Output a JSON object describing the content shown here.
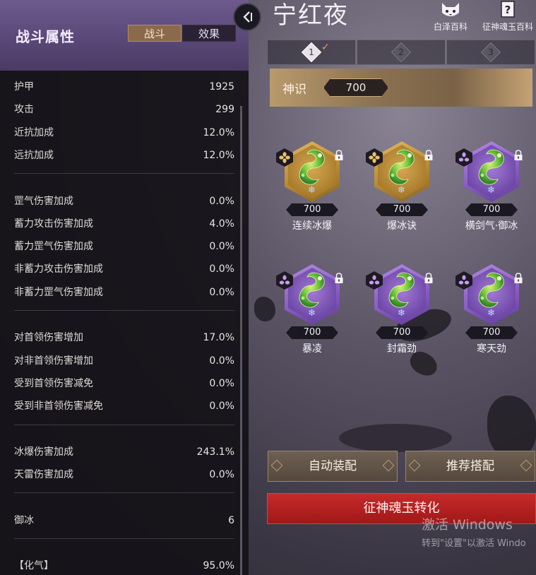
{
  "left_panel": {
    "title": "战斗属性",
    "tabs": [
      {
        "label": "战斗",
        "active": true
      },
      {
        "label": "效果",
        "active": false
      }
    ],
    "groups": [
      [
        {
          "label": "护甲",
          "value": "1925"
        },
        {
          "label": "攻击",
          "value": "299"
        },
        {
          "label": "近抗加成",
          "value": "12.0%"
        },
        {
          "label": "远抗加成",
          "value": "12.0%"
        }
      ],
      [
        {
          "label": "罡气伤害加成",
          "value": "0.0%"
        },
        {
          "label": "蓄力攻击伤害加成",
          "value": "4.0%"
        },
        {
          "label": "蓄力罡气伤害加成",
          "value": "0.0%"
        },
        {
          "label": "非蓄力攻击伤害加成",
          "value": "0.0%"
        },
        {
          "label": "非蓄力罡气伤害加成",
          "value": "0.0%"
        }
      ],
      [
        {
          "label": "对首领伤害增加",
          "value": "17.0%"
        },
        {
          "label": "对非首领伤害增加",
          "value": "0.0%"
        },
        {
          "label": "受到首领伤害减免",
          "value": "0.0%"
        },
        {
          "label": "受到非首领伤害减免",
          "value": "0.0%"
        }
      ],
      [
        {
          "label": "冰爆伤害加成",
          "value": "243.1%"
        },
        {
          "label": "天雷伤害加成",
          "value": "0.0%"
        }
      ],
      [
        {
          "label": "御冰",
          "value": "6"
        }
      ],
      [
        {
          "label": "【化气】",
          "value": "95.0%"
        }
      ]
    ]
  },
  "header": {
    "title": "宁红夜",
    "links": [
      {
        "label": "白泽百科",
        "icon": "baize-cat-icon"
      },
      {
        "label": "征神魂玉百科",
        "icon": "book-question-icon"
      }
    ]
  },
  "tabs": [
    {
      "number": "1",
      "selected": true
    },
    {
      "number": "2",
      "selected": false
    },
    {
      "number": "3",
      "selected": false
    }
  ],
  "shenshi": {
    "label": "神识",
    "value": "700"
  },
  "jades": [
    {
      "name": "连续冰爆",
      "cost": "700",
      "rarity": "gold",
      "rank_icon": "four-petal-icon",
      "locked": true
    },
    {
      "name": "爆冰诀",
      "cost": "700",
      "rarity": "gold",
      "rank_icon": "four-petal-icon",
      "locked": true
    },
    {
      "name": "横剑气·御冰",
      "cost": "700",
      "rarity": "purple",
      "rank_icon": "three-petal-icon",
      "locked": true
    },
    {
      "name": "暴凌",
      "cost": "700",
      "rarity": "purple",
      "rank_icon": "three-petal-icon",
      "locked": true
    },
    {
      "name": "封霜劲",
      "cost": "700",
      "rarity": "purple",
      "rank_icon": "three-petal-icon",
      "locked": true
    },
    {
      "name": "寒天劲",
      "cost": "700",
      "rarity": "purple",
      "rank_icon": "three-petal-icon",
      "locked": true
    }
  ],
  "buttons": {
    "auto_equip": "自动装配",
    "recommend": "推荐搭配",
    "convert": "征神魂玉转化"
  },
  "watermark": {
    "line1": "激活 Windows",
    "line2": "转到\"设置\"以激活 Windo"
  },
  "colors": {
    "accent_gold": "#b89a6c",
    "accent_red": "#c62a2a",
    "panel_purple": "#5a4878"
  }
}
